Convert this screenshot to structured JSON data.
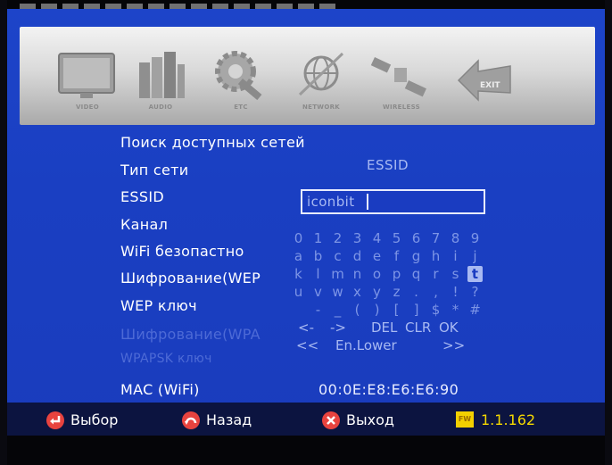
{
  "menu": {
    "items": [
      {
        "label": "VIDEO",
        "icon": "tv-icon"
      },
      {
        "label": "AUDIO",
        "icon": "speaker-icon"
      },
      {
        "label": "ETC",
        "icon": "wrench-gear-icon"
      },
      {
        "label": "NETWORK",
        "icon": "globe-icon"
      },
      {
        "label": "WIRELESS",
        "icon": "satellite-icon"
      },
      {
        "label": "EXIT",
        "icon": "exit-arrow-icon"
      }
    ]
  },
  "settings": {
    "search_networks": "Поиск доступных сетей",
    "network_type_label": "Тип сети",
    "network_type_value": "ESSID",
    "essid_label": "ESSID",
    "essid_value": "iconbit",
    "channel_label": "Канал",
    "wifi_security_label": "WiFi безопастно",
    "encryption_wep_label": "Шифрование(WEP",
    "wep_key_label": "WEP ключ",
    "encryption_wpa_label": "Шифрование(WPA",
    "wpapsk_key_label": "WPAPSK ключ",
    "mac_label": "MAC (WiFi)",
    "mac_value": "00:0E:E8:E6:E6:90"
  },
  "keyboard": {
    "rows": [
      [
        "0",
        "1",
        "2",
        "3",
        "4",
        "5",
        "6",
        "7",
        "8",
        "9"
      ],
      [
        "a",
        "b",
        "c",
        "d",
        "e",
        "f",
        "g",
        "h",
        "i",
        "j"
      ],
      [
        "k",
        "l",
        "m",
        "n",
        "o",
        "p",
        "q",
        "r",
        "s",
        "t"
      ],
      [
        "u",
        "v",
        "w",
        "x",
        "y",
        "z",
        ".",
        ",",
        "!",
        "?"
      ],
      [
        "",
        "-",
        "_",
        "(",
        ")",
        "[",
        "]",
        "$",
        "*",
        "#"
      ]
    ],
    "selected_key": "t",
    "left_arrow": "<-",
    "right_arrow": "->",
    "del": "DEL",
    "clr": "CLR",
    "ok": "OK",
    "prev_layout": "<<",
    "layout_name": "En.Lower",
    "next_layout": ">>"
  },
  "footer": {
    "select_label": "Выбор",
    "back_label": "Назад",
    "exit_label": "Выход",
    "fw_badge": "FW",
    "fw_version": "1.1.162"
  },
  "colors": {
    "background_blue": "#1a3fc2",
    "footer_navy": "#0c1440",
    "selected_key_bg": "#a8b9f2",
    "version_yellow": "#f5d800"
  }
}
